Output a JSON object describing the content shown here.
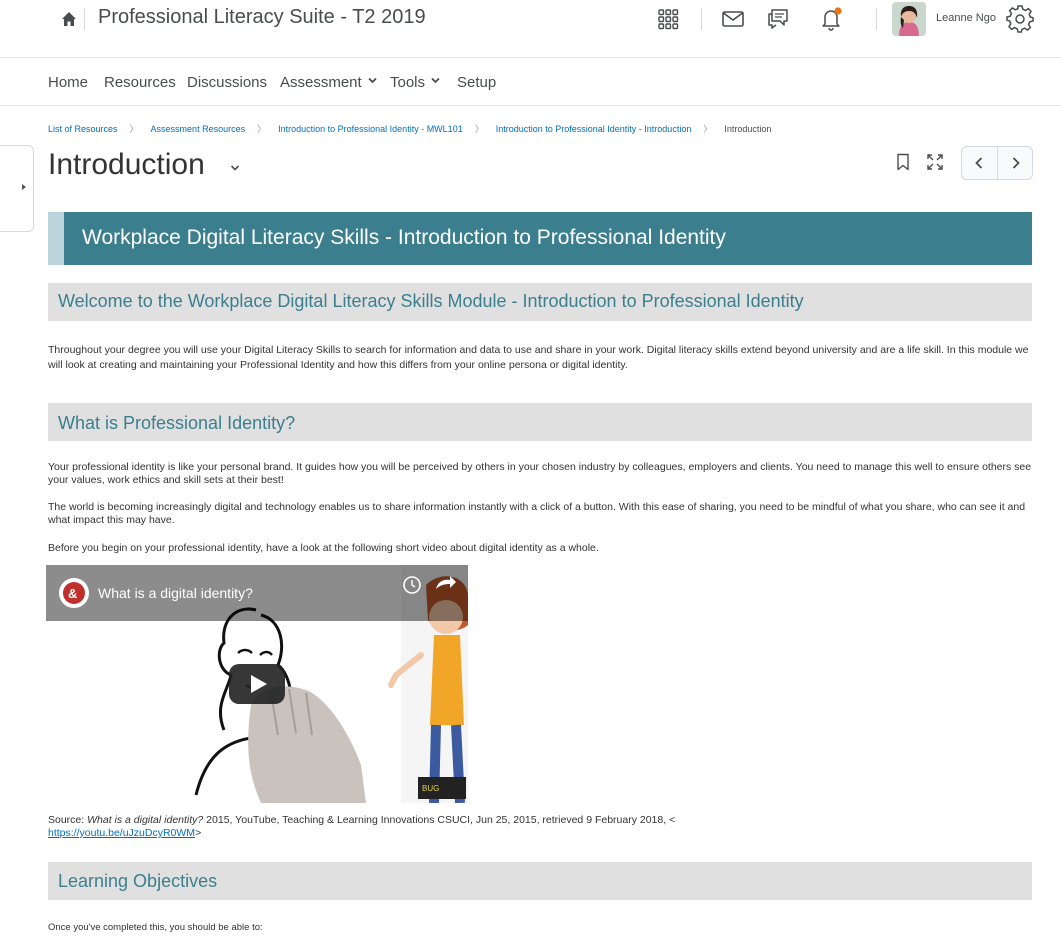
{
  "header": {
    "course_title": "Professional Literacy Suite - T2 2019",
    "user_name": "Leanne Ngo",
    "icons": [
      "home-icon",
      "apps-grid-icon",
      "mail-icon",
      "chat-icon",
      "bell-icon",
      "gear-icon"
    ],
    "notification_dot_color": "#e87511"
  },
  "nav": {
    "home": "Home",
    "resources": "Resources",
    "discussions": "Discussions",
    "assessment": "Assessment",
    "tools": "Tools",
    "setup": "Setup"
  },
  "breadcrumb": {
    "items": [
      "List of Resources",
      "Assessment Resources",
      "Introduction to Professional Identity - MWL101",
      "Introduction to Professional Identity - Introduction"
    ],
    "current": "Introduction"
  },
  "page": {
    "title": "Introduction"
  },
  "content": {
    "banner": "Workplace Digital Literacy Skills - Introduction to Professional Identity",
    "welcome_heading": "Welcome to the Workplace Digital Literacy Skills Module - Introduction to Professional Identity",
    "welcome_text": "Throughout your degree you will use your Digital Literacy Skills to search for information and data to use and share in your work. Digital literacy skills extend beyond university and are a life skill. In this module we will look at creating and maintaining your Professional Identity and how this differs from your online persona or digital identity.",
    "what_heading": "What is Professional Identity?",
    "what_p1": "Your professional identity is like your personal brand. It guides how you will be perceived by others in your chosen industry by colleagues, employers and clients. You need to manage this well to ensure others see your values, work ethics and skill sets at their best!",
    "what_p2": "The world is becoming increasingly digital and technology enables us to share information instantly with a click of a button. With this ease of sharing, you need to be mindful of what you share, who can see it and what impact this may have.",
    "what_p3": "Before you begin on your professional identity, have a look at the following short video about digital identity as a whole.",
    "video_title": "What is a digital identity?",
    "source_prefix": "Source: ",
    "source_title": "What is a digital identity?",
    "source_rest": " 2015, YouTube, Teaching & Learning Innovations CSUCI, Jun 25, 2015, retrieved 9 February 2018, <",
    "source_link": "https://youtu.be/uJzuDcyR0WM",
    "source_close": ">",
    "objectives_heading": "Learning Objectives",
    "objectives_intro": "Once you've completed this, you should be able to:"
  },
  "colors": {
    "banner": "#3b7f8f",
    "heading_bg": "#e0e0e0",
    "link": "#006fbf"
  }
}
